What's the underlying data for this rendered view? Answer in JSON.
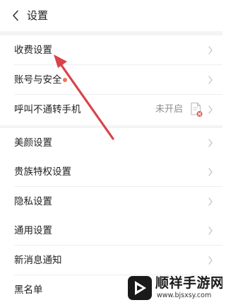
{
  "header": {
    "title": "设置",
    "back_icon": "chevron-left-icon"
  },
  "settings": {
    "group1": [
      {
        "label": "收费设置"
      },
      {
        "label": "账号与安全",
        "has_red_dot": true
      },
      {
        "label": "呼叫不通转手机",
        "status": "未开启"
      }
    ],
    "group2": [
      {
        "label": "美颜设置"
      },
      {
        "label": "贵族特权设置"
      },
      {
        "label": "隐私设置"
      },
      {
        "label": "通用设置"
      },
      {
        "label": "新消息通知"
      },
      {
        "label": "黑名单"
      }
    ]
  },
  "annotation": {
    "arrow_color": "#d9434b",
    "points_to": "收费设置"
  },
  "watermark": {
    "title": "顺祥手游网",
    "url": "www.bjsxsy.com"
  },
  "colors": {
    "background": "#ffffff",
    "section_gap": "#f4f4f4",
    "red_dot": "#f0725c",
    "secondary_text": "#8c8c8c"
  }
}
